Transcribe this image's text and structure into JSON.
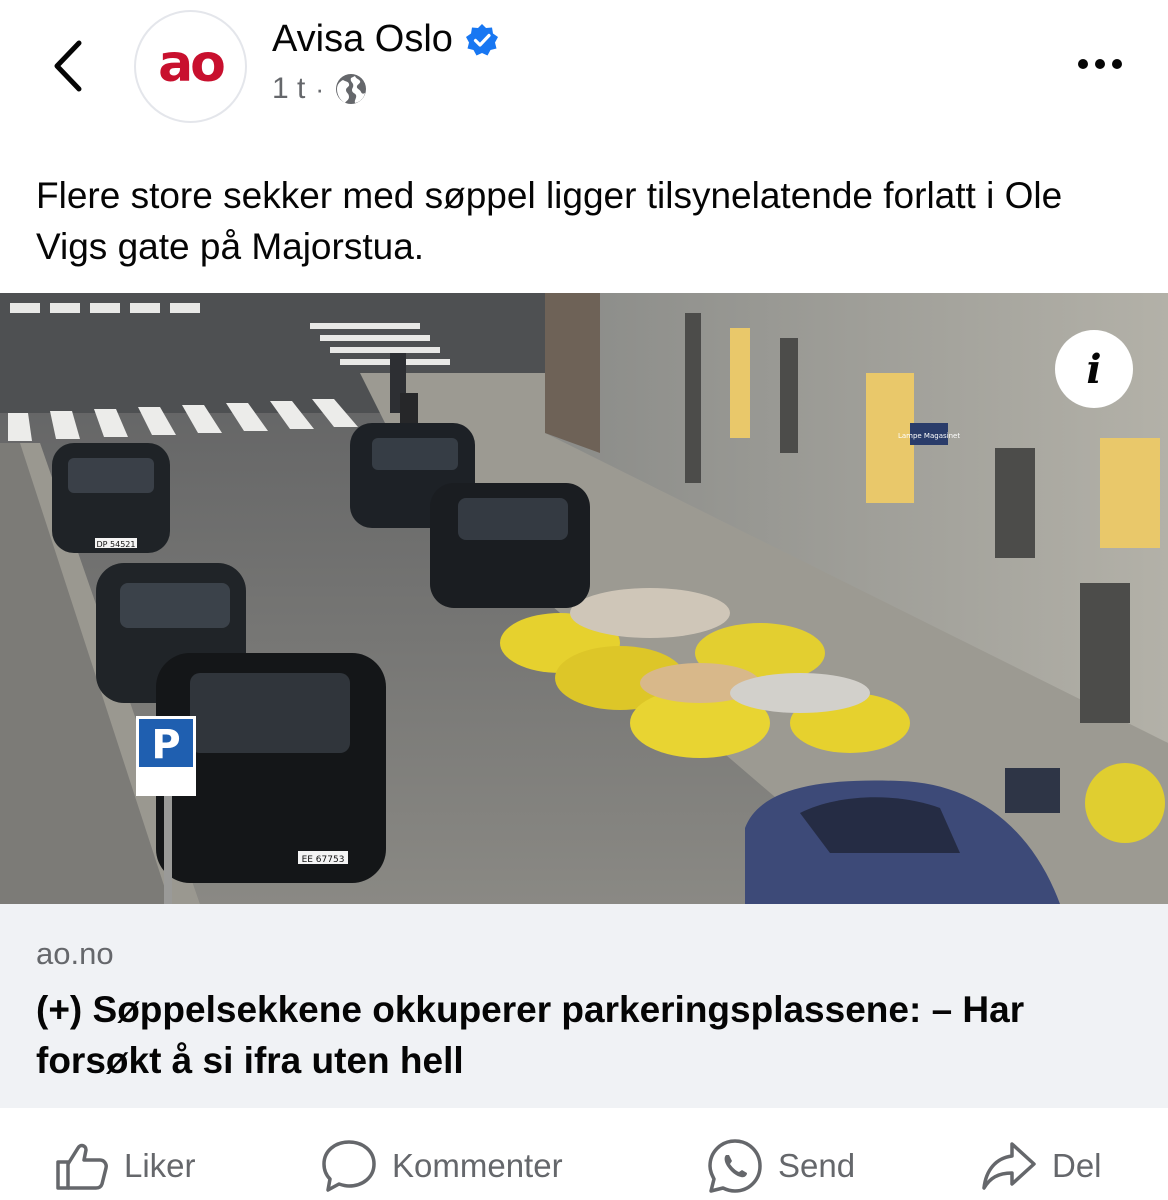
{
  "header": {
    "page_name": "Avisa Oslo",
    "avatar_text": "ao",
    "time": "1 t",
    "separator": "·",
    "verified_icon": "verified-badge-icon",
    "audience_icon": "globe-icon"
  },
  "post": {
    "text": "Flere store sekker med søppel ligger tilsynelatende forlatt i Ole Vigs gate på Majorstua."
  },
  "photo": {
    "parking_sign": "P",
    "plate_1": "DP 54521",
    "plate_2": "EE 67753",
    "shop_sign": "Lampe Magasinet",
    "info_icon": "i"
  },
  "link": {
    "domain": "ao.no",
    "title": "(+) Søppelsekkene okkuperer parkeringsplassene: – Har forsøkt å si ifra uten hell"
  },
  "actions": {
    "like": "Liker",
    "comment": "Kommenter",
    "send": "Send",
    "share": "Del"
  },
  "colors": {
    "brand": "#c8102e",
    "verified": "#1877f2",
    "secondary_text": "#65676b",
    "card_background": "#f0f2f5"
  }
}
